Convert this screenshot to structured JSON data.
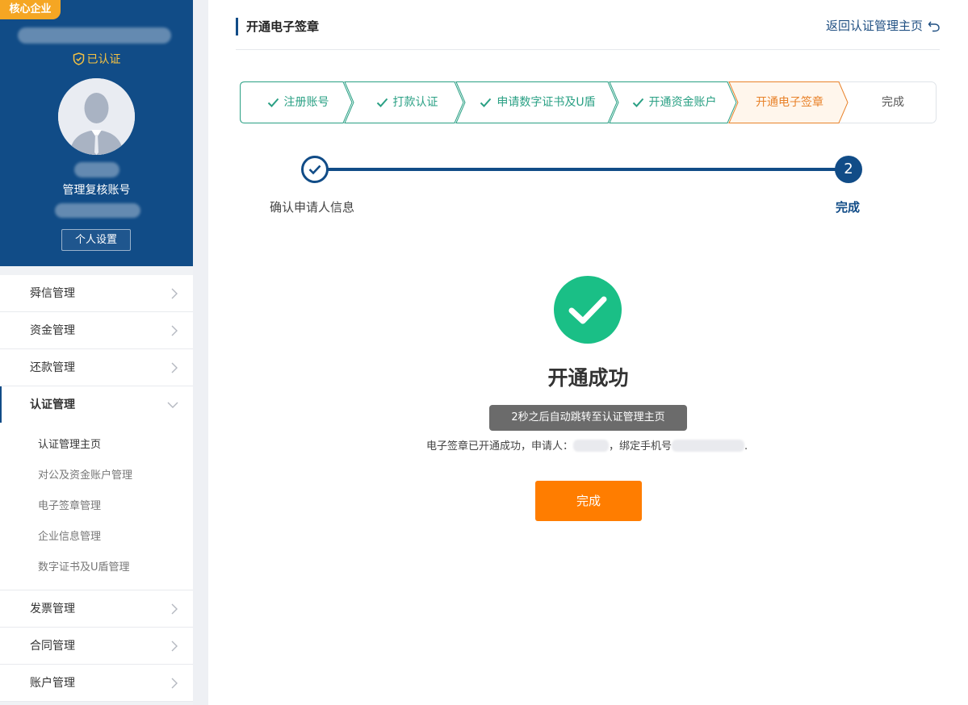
{
  "sidebar": {
    "badge": "核心企业",
    "certified_text": "已认证",
    "role_name": "管理复核账号",
    "settings_button": "个人设置",
    "menu": [
      {
        "label": "舜信管理"
      },
      {
        "label": "资金管理"
      },
      {
        "label": "还款管理"
      },
      {
        "label": "认证管理",
        "expanded": true
      },
      {
        "label": "发票管理"
      },
      {
        "label": "合同管理"
      },
      {
        "label": "账户管理"
      }
    ],
    "submenu": [
      {
        "label": "认证管理主页",
        "active": true
      },
      {
        "label": "对公及资金账户管理"
      },
      {
        "label": "电子签章管理"
      },
      {
        "label": "企业信息管理"
      },
      {
        "label": "数字证书及U盾管理"
      }
    ]
  },
  "header": {
    "title": "开通电子签章",
    "back_link": "返回认证管理主页"
  },
  "steps": [
    {
      "label": "注册账号",
      "status": "done"
    },
    {
      "label": "打款认证",
      "status": "done"
    },
    {
      "label": "申请数字证书及U盾",
      "status": "done"
    },
    {
      "label": "开通资金账户",
      "status": "done"
    },
    {
      "label": "开通电子签章",
      "status": "current"
    },
    {
      "label": "完成",
      "status": "todo"
    }
  ],
  "progress": {
    "step1_label": "确认申请人信息",
    "step2_number": "2",
    "step2_label": "完成"
  },
  "result": {
    "title": "开通成功",
    "toast": "2秒之后自动跳转至认证管理主页",
    "desc_prefix": "电子签章已开通成功，申请人：",
    "desc_middle": "，绑定手机号",
    "desc_suffix": ".",
    "finish_button": "完成"
  },
  "colors": {
    "primary": "#114c87",
    "success": "#1abf86",
    "step_done": "#2aa084",
    "step_current": "#e8822a",
    "action": "#ff7d00",
    "badge": "#f5a623"
  }
}
